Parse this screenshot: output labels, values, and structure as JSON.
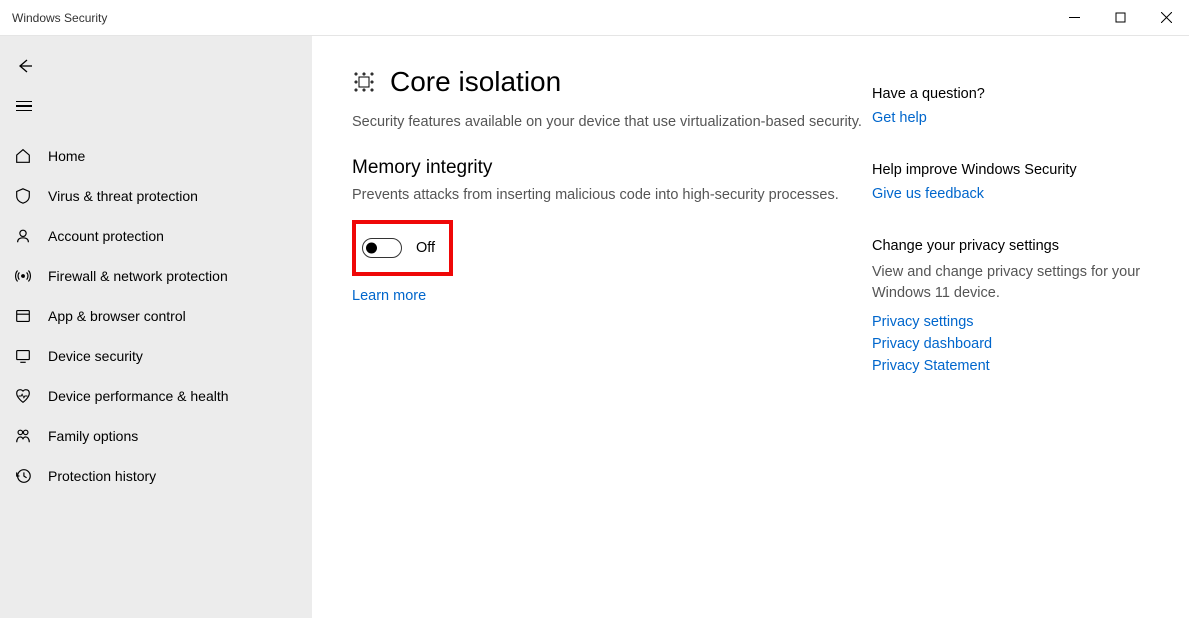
{
  "titlebar": {
    "title": "Windows Security"
  },
  "sidebar": {
    "items": [
      {
        "label": "Home"
      },
      {
        "label": "Virus & threat protection"
      },
      {
        "label": "Account protection"
      },
      {
        "label": "Firewall & network protection"
      },
      {
        "label": "App & browser control"
      },
      {
        "label": "Device security"
      },
      {
        "label": "Device performance & health"
      },
      {
        "label": "Family options"
      },
      {
        "label": "Protection history"
      }
    ]
  },
  "main": {
    "title": "Core isolation",
    "subtitle": "Security features available on your device that use virtualization-based security.",
    "section_title": "Memory integrity",
    "section_desc": "Prevents attacks from inserting malicious code into high-security processes.",
    "toggle_state": "Off",
    "learn_more": "Learn more"
  },
  "aside": {
    "question": {
      "title": "Have a question?",
      "link": "Get help"
    },
    "improve": {
      "title": "Help improve Windows Security",
      "link": "Give us feedback"
    },
    "privacy": {
      "title": "Change your privacy settings",
      "desc": "View and change privacy settings for your Windows 11 device.",
      "links": [
        "Privacy settings",
        "Privacy dashboard",
        "Privacy Statement"
      ]
    }
  }
}
